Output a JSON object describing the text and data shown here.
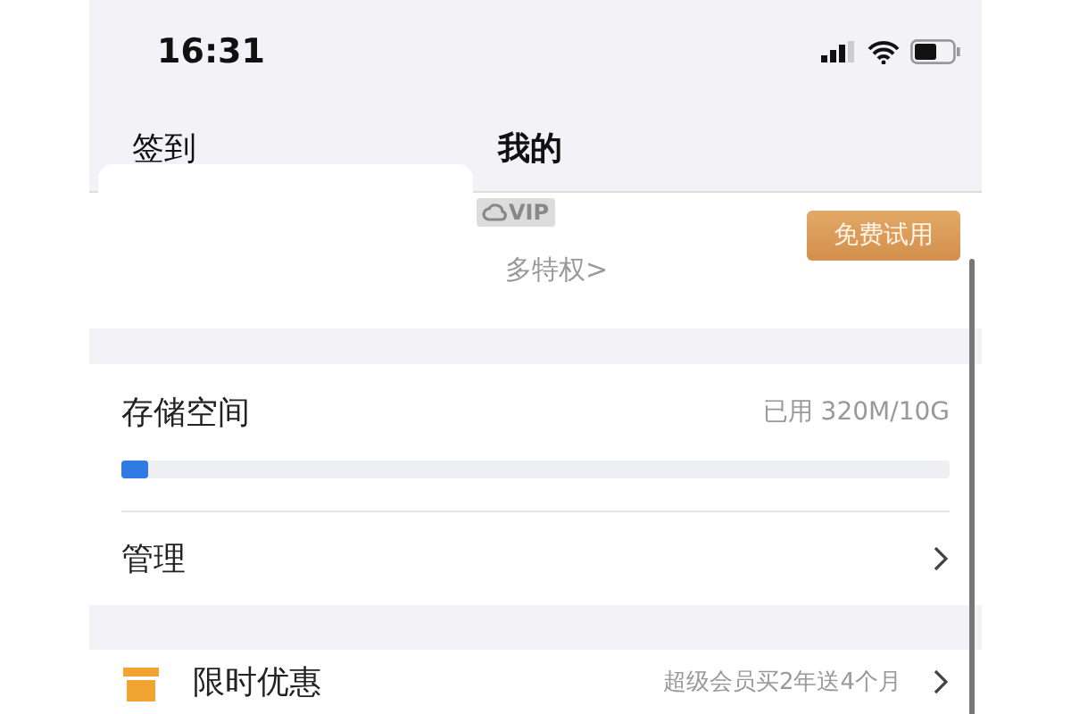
{
  "status_bar": {
    "time": "16:31"
  },
  "nav": {
    "left": "签到",
    "title": "我的"
  },
  "profile": {
    "badge": "VIP",
    "link": "多特权>",
    "trial_button": "免费试用"
  },
  "storage": {
    "title": "存储空间",
    "reading": "已用 320M/10G",
    "level": 0.032
  },
  "manage": {
    "label": "管理"
  },
  "promo": {
    "label": "限时优惠",
    "detail": "超级会员买2年送4个月"
  }
}
